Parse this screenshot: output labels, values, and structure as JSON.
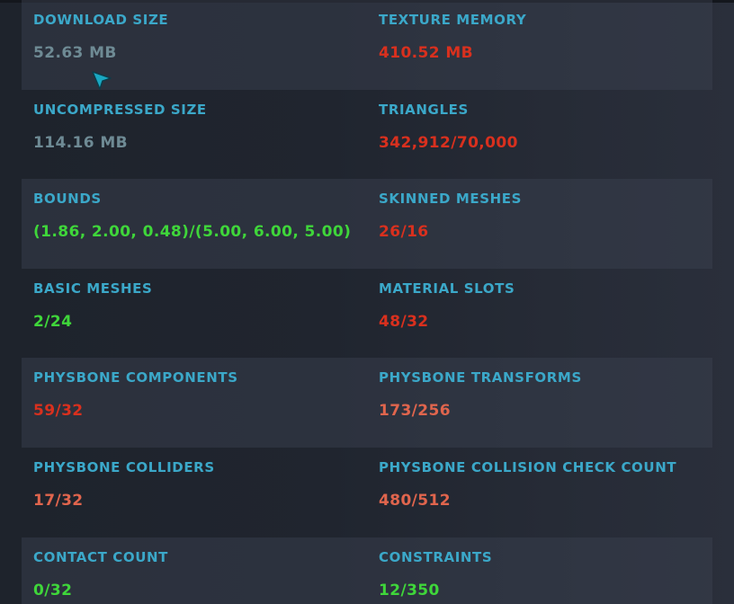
{
  "stats": [
    {
      "left": {
        "label": "DOWNLOAD SIZE",
        "value": "52.63 MB",
        "status": "neutral"
      },
      "right": {
        "label": "TEXTURE MEMORY",
        "value": "410.52 MB",
        "status": "bad"
      }
    },
    {
      "left": {
        "label": "UNCOMPRESSED SIZE",
        "value": "114.16 MB",
        "status": "neutral"
      },
      "right": {
        "label": "TRIANGLES",
        "value": "342,912/70,000",
        "status": "bad"
      }
    },
    {
      "left": {
        "label": "BOUNDS",
        "value": "(1.86, 2.00, 0.48)/(5.00, 6.00, 5.00)",
        "status": "good"
      },
      "right": {
        "label": "SKINNED MESHES",
        "value": "26/16",
        "status": "bad"
      }
    },
    {
      "left": {
        "label": "BASIC MESHES",
        "value": "2/24",
        "status": "good"
      },
      "right": {
        "label": "MATERIAL SLOTS",
        "value": "48/32",
        "status": "bad"
      }
    },
    {
      "left": {
        "label": "PHYSBONE COMPONENTS",
        "value": "59/32",
        "status": "bad"
      },
      "right": {
        "label": "PHYSBONE TRANSFORMS",
        "value": "173/256",
        "status": "warn"
      }
    },
    {
      "left": {
        "label": "PHYSBONE COLLIDERS",
        "value": "17/32",
        "status": "warn"
      },
      "right": {
        "label": "PHYSBONE COLLISION CHECK COUNT",
        "value": "480/512",
        "status": "warn"
      }
    },
    {
      "left": {
        "label": "CONTACT COUNT",
        "value": "0/32",
        "status": "good"
      },
      "right": {
        "label": "CONSTRAINTS",
        "value": "12/350",
        "status": "good"
      }
    }
  ],
  "colors": {
    "label": "#3ba8c9",
    "neutral": "#6e8a94",
    "bad": "#d9301e",
    "warn": "#e0654d",
    "good": "#3fd63a"
  },
  "cursor": {
    "icon": "pointer-cursor-icon"
  }
}
